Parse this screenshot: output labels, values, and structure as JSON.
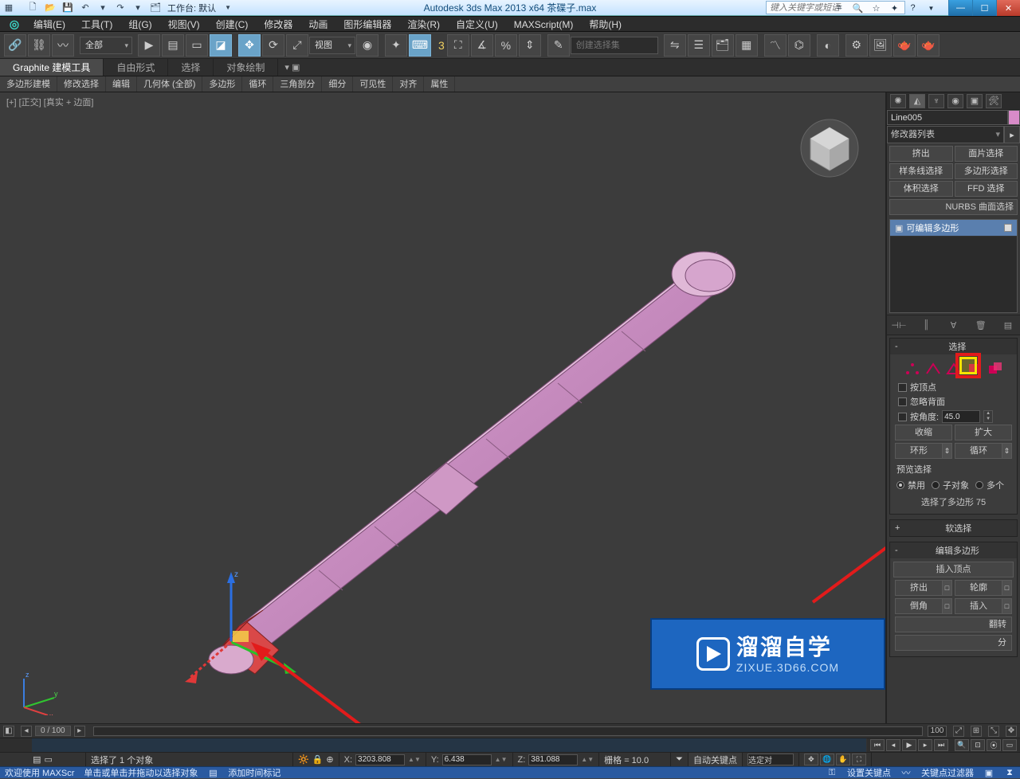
{
  "title": "Autodesk 3ds Max  2013 x64      茶碟子.max",
  "workspace_label": "工作台: 默认",
  "search_placeholder": "键入关键字或短语",
  "menu": [
    "编辑(E)",
    "工具(T)",
    "组(G)",
    "视图(V)",
    "创建(C)",
    "修改器",
    "动画",
    "图形编辑器",
    "渲染(R)",
    "自定义(U)",
    "MAXScript(M)",
    "帮助(H)"
  ],
  "ribbon_tabs": [
    "Graphite 建模工具",
    "自由形式",
    "选择",
    "对象绘制"
  ],
  "ribbon_chips": [
    "多边形建模",
    "修改选择",
    "编辑",
    "几何体 (全部)",
    "多边形",
    "循环",
    "三角剖分",
    "细分",
    "可见性",
    "对齐",
    "属性"
  ],
  "toolbar_filter": "全部",
  "toolbar_coord": "视图",
  "toolbar_selset": "创建选择集",
  "tool_angle_label": "3",
  "viewport_label": "[+] [正交] [真实 + 边面]",
  "object_name": "Line005",
  "mod_list_label": "修改器列表",
  "mod_buttons_row": [
    [
      "挤出",
      "面片选择"
    ],
    [
      "样条线选择",
      "多边形选择"
    ],
    [
      "体积选择",
      "FFD 选择"
    ]
  ],
  "mod_wide": "NURBS 曲面选择",
  "stack_item": "可编辑多边形",
  "roll_select": {
    "title": "选择",
    "chk_by_vertex": "按顶点",
    "chk_ignore_back": "忽略背面",
    "chk_by_angle": "按角度:",
    "angle_value": "45.0",
    "shrink": "收缩",
    "grow": "扩大",
    "ring": "环形",
    "loop": "循环",
    "preview_label": "预览选择",
    "r_disable": "禁用",
    "r_subobj": "子对象",
    "r_multi": "多个",
    "selected_info": "选择了多边形 75"
  },
  "roll_soft": "软选择",
  "roll_edit_poly": {
    "title": "编辑多边形",
    "insert_vertex": "插入顶点",
    "extrude": "挤出",
    "outline": "轮廓",
    "bevel": "倒角",
    "inset": "插入",
    "flip": "翻转",
    "sep": "分"
  },
  "time": {
    "frame_label": "0 / 100",
    "range_end": "100"
  },
  "status": {
    "selected": "选择了 1 个对象",
    "x": "3203.808",
    "y": "6.438",
    "z": "381.088",
    "grid": "栅格 = 10.0",
    "autokey": "自动关键点",
    "setkey": "设置关键点",
    "seldd": "选定对",
    "keyfilter": "关键点过滤器",
    "add_time_tag": "添加时间标记",
    "hint": "单击或单击并拖动以选择对象",
    "welcome": "欢迎使用  MAXScr"
  },
  "watermark": {
    "big": "溜溜自学",
    "small": "ZIXUE.3D66.COM"
  }
}
